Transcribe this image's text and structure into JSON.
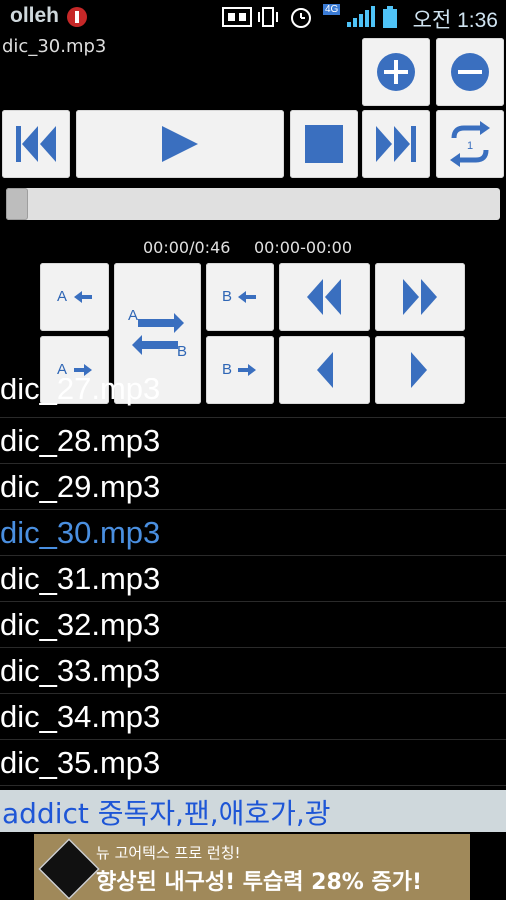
{
  "status_bar": {
    "carrier": "olleh",
    "network_badge": "4G",
    "clock": "오전 1:36",
    "icons": [
      "sync-icon",
      "phone-vibrate-icon",
      "alarm-icon",
      "signal-icon",
      "battery-icon"
    ]
  },
  "player": {
    "current_track": "dic_30.mp3",
    "time_display": "00:00/0:46",
    "ab_range": "00:00-00:00",
    "progress_fraction": 0.0,
    "ab_buttons": {
      "a_left": "A",
      "a_right": "A",
      "b_left": "B",
      "b_right": "B",
      "ab_a": "A",
      "ab_b": "B"
    }
  },
  "playlist": {
    "partial_item": "dic_27.mp3",
    "items": [
      {
        "label": "dic_28.mp3",
        "active": false
      },
      {
        "label": "dic_29.mp3",
        "active": false
      },
      {
        "label": "dic_30.mp3",
        "active": true
      },
      {
        "label": "dic_31.mp3",
        "active": false
      },
      {
        "label": "dic_32.mp3",
        "active": false
      },
      {
        "label": "dic_33.mp3",
        "active": false
      },
      {
        "label": "dic_34.mp3",
        "active": false
      },
      {
        "label": "dic_35.mp3",
        "active": false
      }
    ]
  },
  "dictionary": {
    "text": "addict 중독자,팬,애호가,광"
  },
  "ad": {
    "line1": "뉴 고어텍스 프로 런칭!",
    "line2": "향상된 내구성! 투습력 28% 증가!",
    "logo_text": "GORE-TEX"
  },
  "colors": {
    "accent_blue": "#3a6fbf",
    "active_item": "#4a8fe0",
    "dictionary_text": "#1e56d6"
  }
}
